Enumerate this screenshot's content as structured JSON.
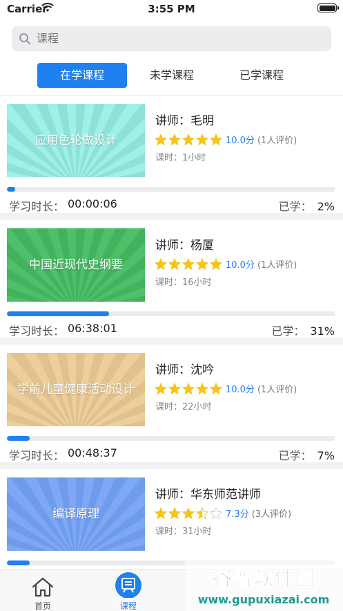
{
  "status_bar": {
    "carrier": "Carrier",
    "time": "3:55 PM"
  },
  "search": {
    "placeholder": "课程"
  },
  "tabs": [
    {
      "label": "在学课程",
      "active": true
    },
    {
      "label": "未学课程",
      "active": false
    },
    {
      "label": "已学课程",
      "active": false
    }
  ],
  "courses": [
    {
      "title": "应用色轮做设计",
      "teacher": "讲师：毛明",
      "rating": 5,
      "score": "10.0分",
      "reviews": "(1人评价)",
      "hours": "课时：1小时",
      "progress": 0.02,
      "study_label": "学习时长：",
      "study_time": "00:00:06",
      "learned_label": "已学：",
      "learned_value": "2%",
      "bg": "#9ff0e6",
      "bg_dark": "#7fd6cc"
    },
    {
      "title": "中国近现代史纲要",
      "teacher": "讲师：杨厦",
      "rating": 5,
      "score": "10.0分",
      "reviews": "(1人评价)",
      "hours": "课时：16小时",
      "progress": 0.31,
      "study_label": "学习时长：",
      "study_time": "06:38:01",
      "learned_label": "已学：",
      "learned_value": "31%",
      "bg": "#4fbf6a",
      "bg_dark": "#3aa756"
    },
    {
      "title": "学前儿童健康活动设计",
      "teacher": "讲师：沈吟",
      "rating": 5,
      "score": "10.0分",
      "reviews": "(1人评价)",
      "hours": "课时：22小时",
      "progress": 0.07,
      "study_label": "学习时长：",
      "study_time": "00:48:37",
      "learned_label": "已学：",
      "learned_value": "7%",
      "bg": "#eccf9c",
      "bg_dark": "#d8b67f"
    },
    {
      "title": "编译原理",
      "teacher": "讲师：华东师范讲师",
      "rating": 3.5,
      "score": "7.3分",
      "reviews": "(3人评价)",
      "hours": "课时：31小时",
      "progress": 0.07,
      "bg": "#7ea8f4",
      "bg_dark": "#628fe6"
    }
  ],
  "tabbar": [
    {
      "label": "首页",
      "icon": "home-icon",
      "active": false
    },
    {
      "label": "课程",
      "icon": "course-icon",
      "active": true
    },
    {
      "label": "",
      "icon": "tab-icon-3",
      "active": false
    },
    {
      "label": "",
      "icon": "tab-icon-4",
      "active": false
    }
  ],
  "watermark": {
    "text": "谷普软件园",
    "url_text": "www.gupuxiazai.com"
  },
  "colors": {
    "accent": "#1f80f0",
    "star": "#f5c518"
  }
}
